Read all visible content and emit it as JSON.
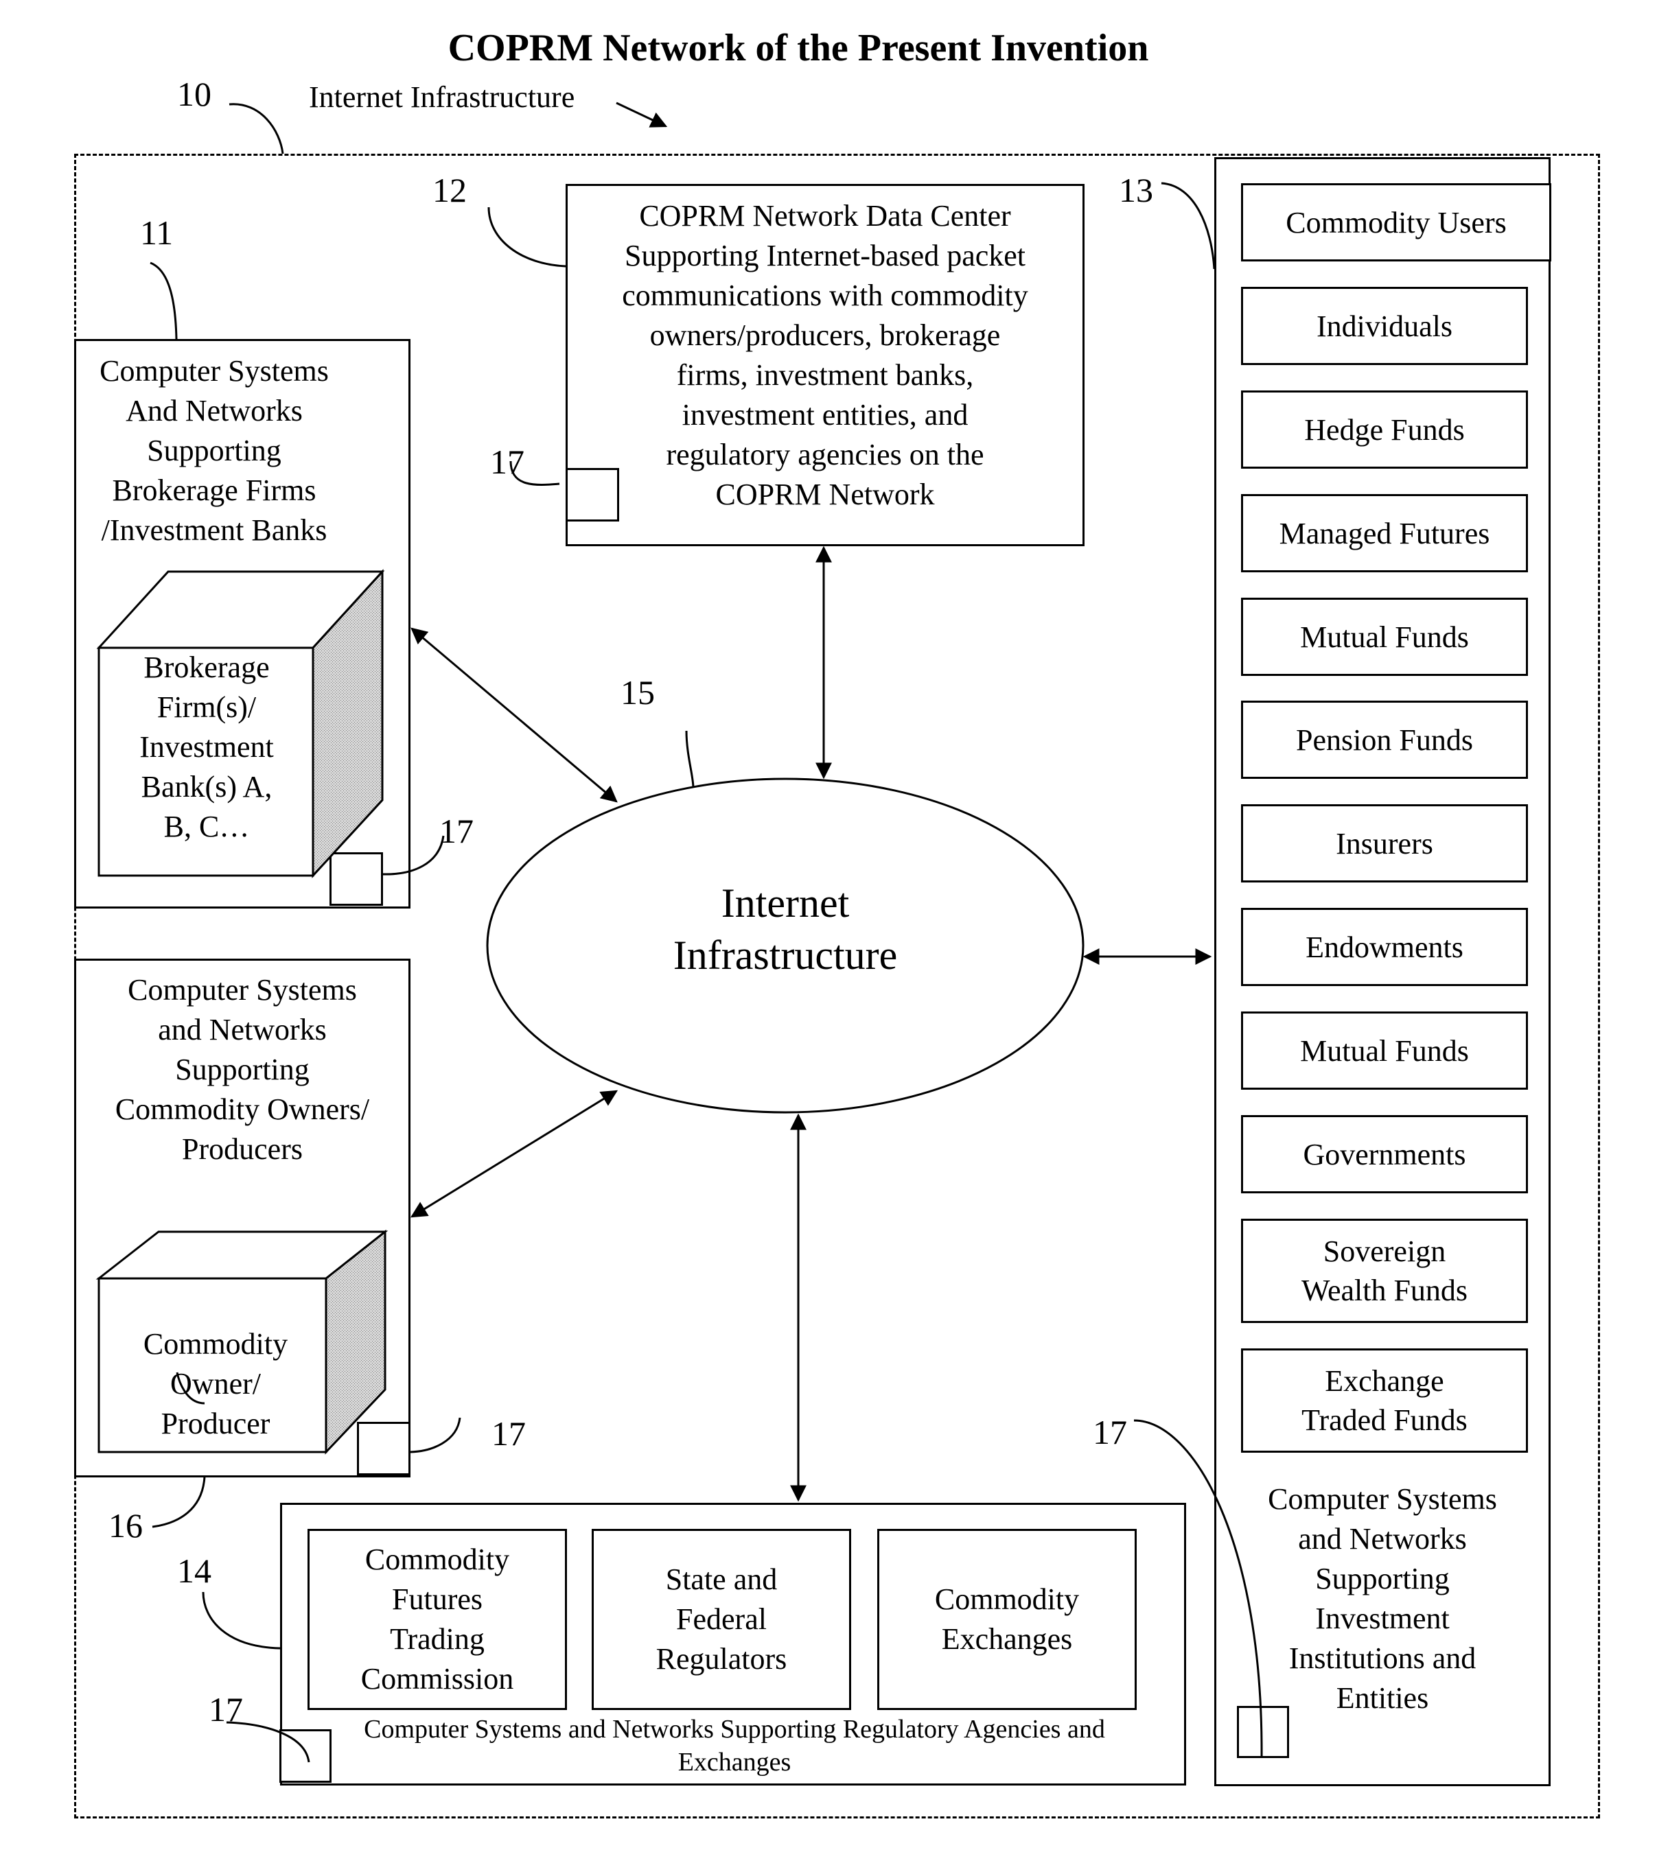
{
  "title": "COPRM Network of the Present Invention",
  "header": {
    "ref_network": "10",
    "internet_label": "Internet Infrastructure"
  },
  "data_center": {
    "ref": "12",
    "text": "COPRM Network Data Center\nSupporting Internet-based packet\ncommunications with commodity\nowners/producers, brokerage\nfirms, investment banks,\ninvestment entities, and\nregulatory agencies on the\nCOPRM Network",
    "module_ref": "17"
  },
  "brokerage": {
    "ref": "11",
    "text": "Computer Systems\nAnd Networks\nSupporting\nBrokerage Firms\n/Investment Banks",
    "cube_label": "Brokerage\nFirm(s)/\nInvestment\nBank(s) A,\nB, C…",
    "module_ref": "17"
  },
  "owners": {
    "ref": "16",
    "text": "Computer Systems\nand Networks\nSupporting\nCommodity Owners/\nProducers",
    "cube_label": "Commodity\nOwner/\nProducer",
    "module_ref": "17"
  },
  "internet": {
    "ref": "15",
    "label": "Internet\nInfrastructure"
  },
  "investment": {
    "ref": "13",
    "items": [
      "Commodity Users",
      "Individuals",
      "Hedge Funds",
      "Managed Futures",
      "Mutual Funds",
      "Pension Funds",
      "Insurers",
      "Endowments",
      "Mutual Funds",
      "Governments",
      "Sovereign\nWealth Funds",
      "Exchange\nTraded Funds"
    ],
    "caption": "Computer Systems\nand Networks\nSupporting\nInvestment\nInstitutions and\nEntities",
    "module_ref": "17"
  },
  "regulatory": {
    "ref": "14",
    "items": [
      "Commodity\nFutures\nTrading\nCommission",
      "State and\nFederal\nRegulators",
      "Commodity\nExchanges"
    ],
    "caption": "Computer Systems and Networks Supporting Regulatory Agencies and\nExchanges",
    "module_ref": "17"
  }
}
